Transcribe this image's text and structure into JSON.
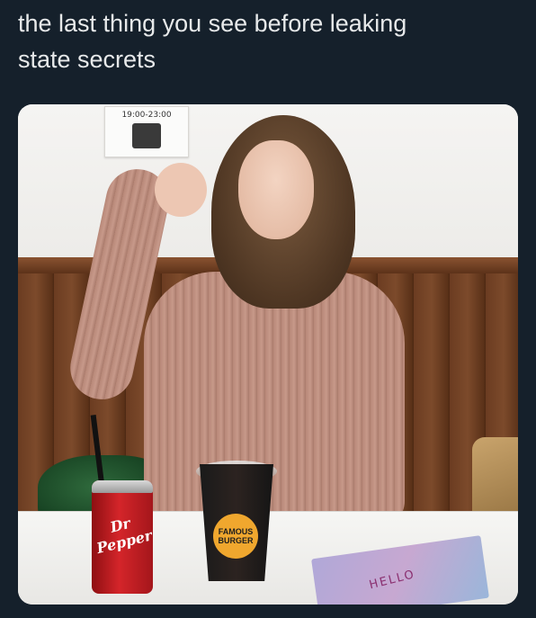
{
  "tweet": {
    "text": "the last thing you see before leaking\nstate secrets"
  },
  "media": {
    "sign_hours": "19:00-23:00",
    "sign_logo_text": "FAMOUS BURGER",
    "can_brand": "Dr Pepper",
    "cup_label": "FAMOUS BURGER",
    "card_text": "HELLO"
  },
  "colors": {
    "background": "#15202b",
    "text": "#e7e9ea"
  }
}
